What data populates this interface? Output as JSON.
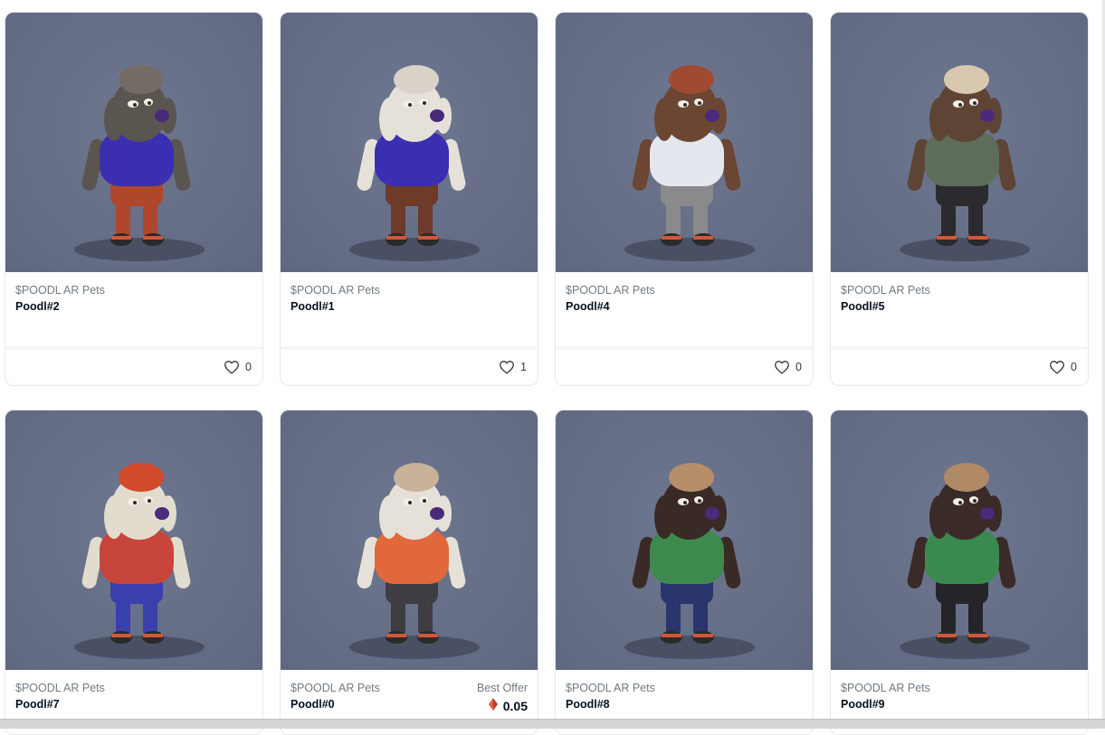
{
  "items": [
    {
      "collection": "$POODL AR Pets",
      "name": "Poodl#2",
      "likes": "0",
      "colors": {
        "fur": "#5b5550",
        "hair": "#726b66",
        "shirt": "#3a2fb0",
        "pants": "#b0462c"
      }
    },
    {
      "collection": "$POODL AR Pets",
      "name": "Poodl#1",
      "likes": "1",
      "colors": {
        "fur": "#e6e1d8",
        "hair": "#d8d2c8",
        "shirt": "#3a2fb0",
        "pants": "#6e3a2a"
      }
    },
    {
      "collection": "$POODL AR Pets",
      "name": "Poodl#4",
      "likes": "0",
      "colors": {
        "fur": "#6b4632",
        "hair": "#a04a32",
        "shirt": "#e4e7ee",
        "pants": "#8a8a8c"
      }
    },
    {
      "collection": "$POODL AR Pets",
      "name": "Poodl#5",
      "likes": "0",
      "colors": {
        "fur": "#5e4435",
        "hair": "#d8c8b0",
        "shirt": "#5c6e5a",
        "pants": "#2b2a2e"
      }
    },
    {
      "collection": "$POODL AR Pets",
      "name": "Poodl#7",
      "colors": {
        "fur": "#e2dccf",
        "hair": "#d04a2c",
        "shirt": "#c8453c",
        "pants": "#3a3fae"
      }
    },
    {
      "collection": "$POODL AR Pets",
      "name": "Poodl#0",
      "offer_label": "Best Offer",
      "price": "0.05",
      "colors": {
        "fur": "#e6e1d8",
        "hair": "#c9b29a",
        "shirt": "#e0683a",
        "pants": "#3d3d42"
      }
    },
    {
      "collection": "$POODL AR Pets",
      "name": "Poodl#8",
      "colors": {
        "fur": "#3a2a26",
        "hair": "#b68e6a",
        "shirt": "#3e8a4e",
        "pants": "#2a356e"
      }
    },
    {
      "collection": "$POODL AR Pets",
      "name": "Poodl#9",
      "colors": {
        "fur": "#3a2a28",
        "hair": "#b08a66",
        "shirt": "#3a8a50",
        "pants": "#252428"
      }
    }
  ],
  "icons": {
    "like": "heart-icon",
    "currency": "ethereum-icon"
  }
}
